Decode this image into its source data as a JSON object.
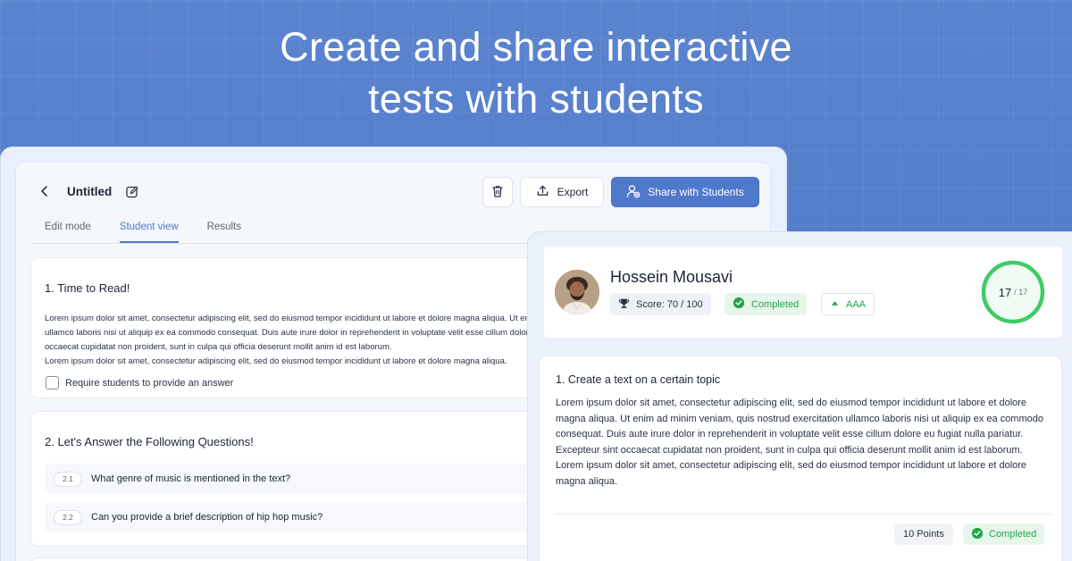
{
  "headline": {
    "line1": "Create and share interactive",
    "line2": "tests with students"
  },
  "editor": {
    "title": "Untitled",
    "export_label": "Export",
    "share_label": "Share with Students",
    "tabs": [
      {
        "label": "Edit mode",
        "active": false
      },
      {
        "label": "Student view",
        "active": true
      },
      {
        "label": "Results",
        "active": false
      }
    ],
    "question1": {
      "title": "1.  Time to Read!",
      "lines": [
        "Lorem ipsum dolor sit amet, consectetur adipiscing elit, sed do eiusmod tempor incididunt ut labore et dolore magna aliqua. Ut enim ad minim veniam, quis nostrud exercitation",
        "ullamco laboris nisi ut aliquip ex ea commodo consequat. Duis aute irure dolor in reprehenderit in voluptate velit esse cillum dolore eu fugiat nulla pariatur. Excepteur sint",
        "occaecat cupidatat non proident, sunt in culpa qui officia deserunt mollit anim id est laborum.",
        "Lorem ipsum dolor sit amet, consectetur adipiscing elit, sed do eiusmod tempor incididunt ut labore et dolore magna aliqua."
      ],
      "checkbox_label": "Require students to provide an answer"
    },
    "question2": {
      "title": "2.  Let's Answer the Following Questions!",
      "sub_questions": [
        {
          "number": "2.1",
          "text": "What genre of music is mentioned in the text?"
        },
        {
          "number": "2.2",
          "text": "Can you provide a brief description of hip hop music?"
        }
      ]
    }
  },
  "result": {
    "student_name": "Hossein Mousavi",
    "score_label": "Score: 70 / 100",
    "status_label": "Completed",
    "level_label": "AAA",
    "ring_main": "17",
    "ring_total": "/ 17",
    "ring_progress": 1.0,
    "answer": {
      "title": "1.  Create a text on a certain topic",
      "paragraph1": "Lorem ipsum dolor sit amet, consectetur adipiscing elit, sed do eiusmod tempor incididunt ut labore et dolore magna aliqua. Ut enim ad minim veniam, quis nostrud exercitation ullamco laboris nisi ut aliquip ex ea commodo consequat. Duis aute irure dolor in reprehenderit in voluptate velit esse cillum dolore eu fugiat nulla pariatur. Excepteur sint occaecat cupidatat non proident, sunt in culpa qui officia deserunt mollit anim id est laborum.",
      "paragraph2": "Lorem ipsum dolor sit amet, consectetur adipiscing elit, sed do eiusmod tempor incididunt ut labore et dolore magna aliqua.",
      "points_label": "10 Points",
      "status_label": "Completed"
    }
  },
  "colors": {
    "accent": "#4f79cb",
    "success": "#22a64a",
    "background": "#4a74c6"
  },
  "icons": {
    "back": "chevron-left-icon",
    "edit": "pencil-icon",
    "delete": "trash-icon",
    "export": "upload-icon",
    "share": "user-add-icon",
    "trophy": "trophy-icon",
    "check": "check-circle-icon",
    "level": "triangle-up-icon"
  }
}
